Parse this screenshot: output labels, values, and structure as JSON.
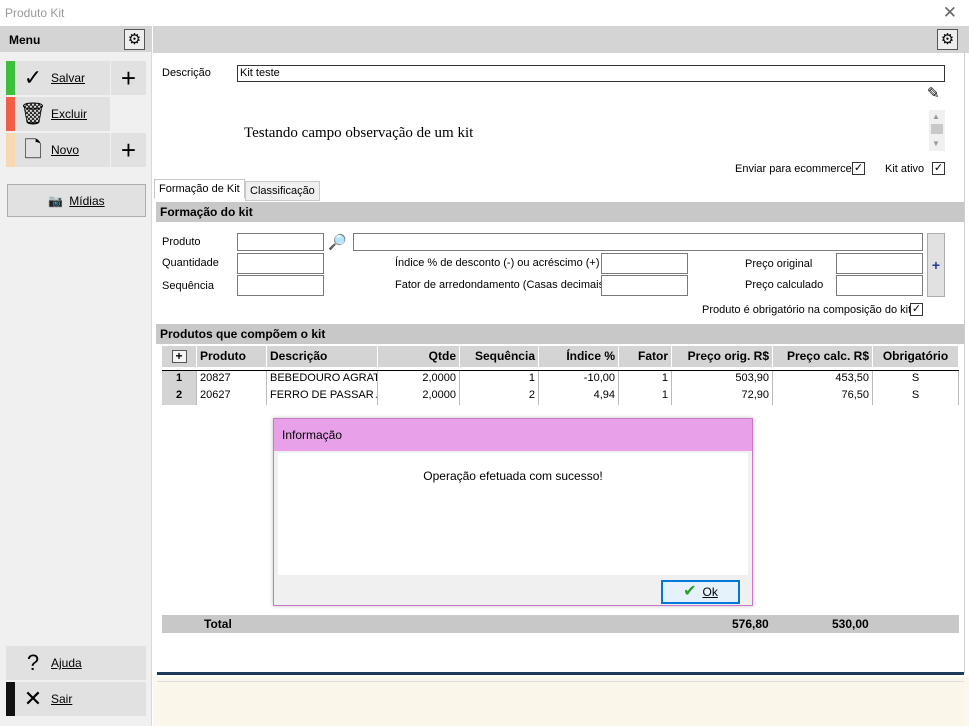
{
  "window": {
    "title": "Produto Kit",
    "close_icon": "close-icon"
  },
  "sidebar": {
    "title": "Menu",
    "salvar": "Salvar",
    "excluir": "Excluir",
    "novo": "Novo",
    "midias": "Mídias",
    "ajuda": "Ajuda",
    "sair": "Sair",
    "colors": {
      "salvar": "#3cc03c",
      "excluir": "#f06048",
      "novo": "#f8d8b0",
      "sair": "#111111"
    }
  },
  "form": {
    "descricao_label": "Descrição",
    "descricao_value": "Kit teste",
    "observacao": "Testando campo observação de um kit",
    "enviar_ecommerce_label": "Enviar para ecommerce",
    "enviar_ecommerce_checked": true,
    "kit_ativo_label": "Kit ativo",
    "kit_ativo_checked": true
  },
  "tabs": [
    {
      "label": "Formação de Kit",
      "active": true
    },
    {
      "label": "Classificação",
      "active": false
    }
  ],
  "formacao": {
    "section_title": "Formação do kit",
    "produto_label": "Produto",
    "produto_value": "",
    "produto_desc_value": "",
    "quantidade_label": "Quantidade",
    "quantidade_value": "",
    "sequencia_label": "Sequência",
    "sequencia_value": "",
    "indice_label": "Índice % de desconto (-) ou acréscimo (+)",
    "indice_value": "",
    "fator_label": "Fator de arredondamento (Casas decimais)",
    "fator_value": "",
    "preco_original_label": "Preço original",
    "preco_original_value": "",
    "preco_calculado_label": "Preço calculado",
    "preco_calculado_value": "",
    "obrigatorio_label": "Produto é obrigatório na composição do kit",
    "obrigatorio_checked": true,
    "add_button": "+"
  },
  "produtos": {
    "section_title": "Produtos que compõem o kit",
    "add_row": "+",
    "columns": [
      "Produto",
      "Descrição",
      "Qtde",
      "Sequência",
      "Índice %",
      "Fator",
      "Preço orig. R$",
      "Preço calc. R$",
      "Obrigatório"
    ],
    "rows": [
      {
        "n": "1",
        "produto": "20827",
        "descricao": "BEBEDOURO AGRATT",
        "qtde": "2,0000",
        "sequencia": "1",
        "indice": "-10,00",
        "fator": "1",
        "preco_orig": "503,90",
        "preco_calc": "453,50",
        "obrigatorio": "S"
      },
      {
        "n": "2",
        "produto": "20627",
        "descricao": "FERRO DE PASSAR A(",
        "qtde": "2,0000",
        "sequencia": "2",
        "indice": "4,94",
        "fator": "1",
        "preco_orig": "72,90",
        "preco_calc": "76,50",
        "obrigatorio": "S"
      }
    ],
    "total_label": "Total",
    "total_orig": "576,80",
    "total_calc": "530,00"
  },
  "dialog": {
    "title": "Informação",
    "message": "Operação efetuada com sucesso!",
    "ok": "Ok",
    "title_color": "#e8a0e8"
  }
}
